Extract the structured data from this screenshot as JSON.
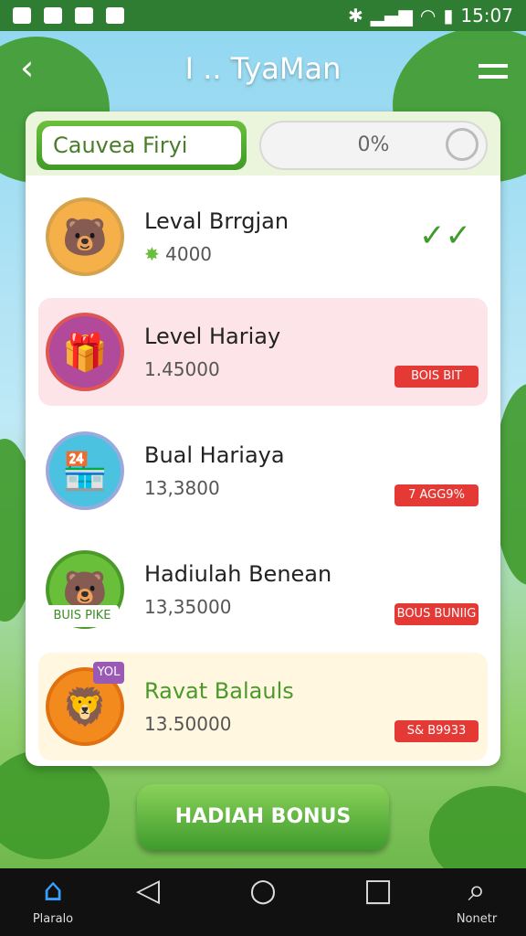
{
  "status_bar": {
    "time": "15:07"
  },
  "header": {
    "back_icon": "back-arrow-icon",
    "title": "I .. TyaMan",
    "menu_icon": "menu-icon"
  },
  "top_bar": {
    "tab_label": "Cauvea Firyi",
    "progress_label": "0%",
    "progress_value": 0
  },
  "items": [
    {
      "name": "Leval Brrgjan",
      "value": "4000",
      "action": "double-check",
      "bg": "#ffffff"
    },
    {
      "name": "Level Hariay",
      "value": "1.45000",
      "action_badge": "BOIS BIT",
      "bg": "#fde4e8"
    },
    {
      "name": "Bual Hariaya",
      "value": "13,3800",
      "action_badge": "7 AGG9%",
      "bg": "#ffffff"
    },
    {
      "name": "Hadiulah Benean",
      "value": "13,35000",
      "avatar_badge": "BUIS PIKE",
      "action_badge": "BOUS BUNIIG",
      "bg": "#ffffff"
    },
    {
      "name": "Ravat Balauls",
      "value": "13.50000",
      "avatar_badge": "YOL",
      "action_badge": "S& B9933",
      "bg": "#fff7e0"
    }
  ],
  "bonus_button": {
    "label": "HADIAH BONUS"
  },
  "nav": [
    {
      "label": "Plaralo",
      "icon": "home-icon"
    },
    {
      "label": "",
      "icon": "back-triangle-icon"
    },
    {
      "label": "",
      "icon": "home-circle-icon"
    },
    {
      "label": "",
      "icon": "recents-square-icon"
    },
    {
      "label": "Nonetr",
      "icon": "search-icon"
    }
  ]
}
